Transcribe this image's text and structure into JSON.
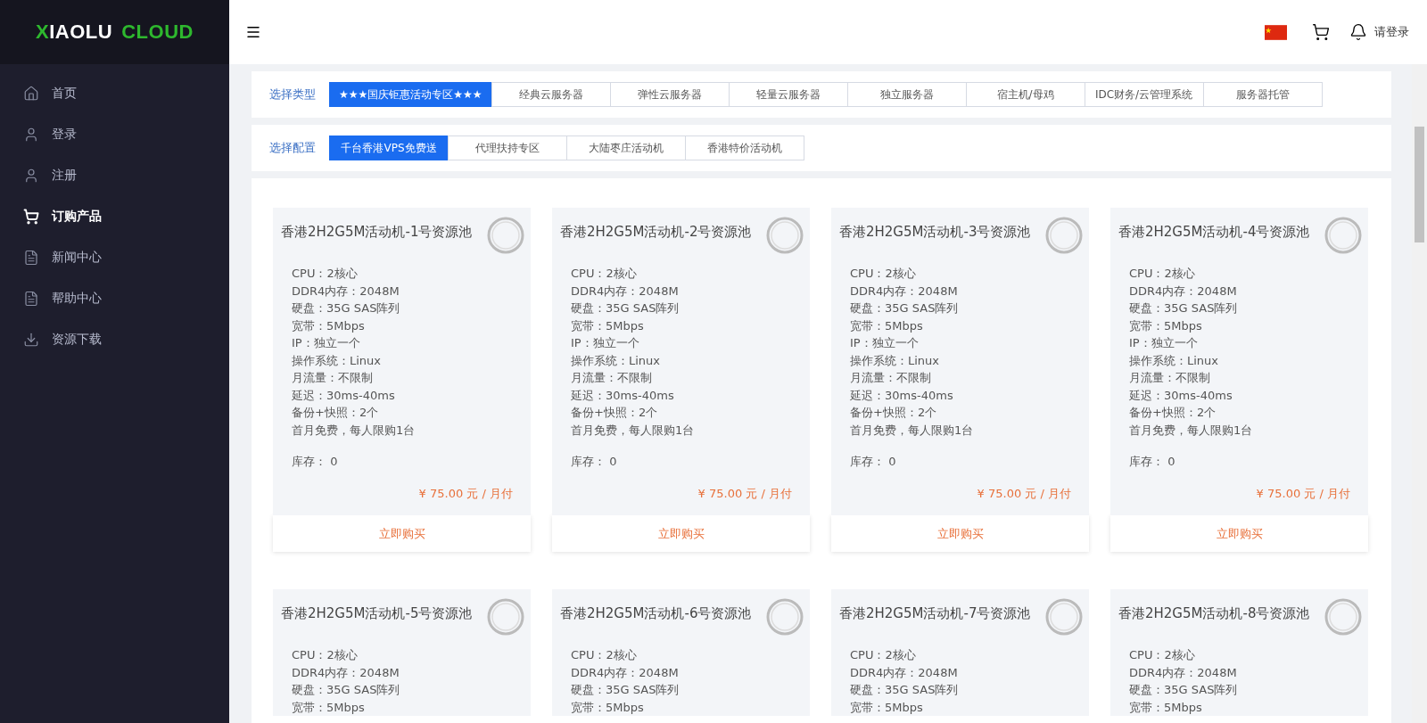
{
  "logo": {
    "mark": "X",
    "first": "IAOLU",
    "second": "CLOUD"
  },
  "sidebar": {
    "items": [
      {
        "label": "首页",
        "selected": false
      },
      {
        "label": "登录",
        "selected": false
      },
      {
        "label": "注册",
        "selected": false
      },
      {
        "label": "订购产品",
        "selected": true
      },
      {
        "label": "新闻中心",
        "selected": false
      },
      {
        "label": "帮助中心",
        "selected": false
      },
      {
        "label": "资源下载",
        "selected": false
      }
    ]
  },
  "header": {
    "login": "请登录"
  },
  "filters": [
    {
      "label": "选择类型",
      "options": [
        {
          "label": "★★★国庆钜惠活动专区★★★",
          "selected": true
        },
        {
          "label": "经典云服务器",
          "selected": false
        },
        {
          "label": "弹性云服务器",
          "selected": false
        },
        {
          "label": "轻量云服务器",
          "selected": false
        },
        {
          "label": "独立服务器",
          "selected": false
        },
        {
          "label": "宿主机/母鸡",
          "selected": false
        },
        {
          "label": "IDC财务/云管理系统",
          "selected": false
        },
        {
          "label": "服务器托管",
          "selected": false
        }
      ]
    },
    {
      "label": "选择配置",
      "options": [
        {
          "label": "千台香港VPS免费送",
          "selected": true
        },
        {
          "label": "代理扶持专区",
          "selected": false
        },
        {
          "label": "大陆枣庄活动机",
          "selected": false
        },
        {
          "label": "香港特价活动机",
          "selected": false
        }
      ]
    }
  ],
  "products": [
    {
      "title": "香港2H2G5M活动机-1号资源池",
      "specs": [
        "CPU：2核心",
        "DDR4内存：2048M",
        "硬盘：35G SAS阵列",
        "宽带：5Mbps",
        "IP：独立一个",
        "操作系统：Linux",
        "月流量：不限制",
        "延迟：30ms-40ms",
        "备份+快照：2个",
        "首月免费，每人限购1台"
      ],
      "stock": "库存： 0",
      "price": "¥ 75.00 元 / 月付",
      "button": "立即购买"
    },
    {
      "title": "香港2H2G5M活动机-2号资源池",
      "specs": [
        "CPU：2核心",
        "DDR4内存：2048M",
        "硬盘：35G SAS阵列",
        "宽带：5Mbps",
        "IP：独立一个",
        "操作系统：Linux",
        "月流量：不限制",
        "延迟：30ms-40ms",
        "备份+快照：2个",
        "首月免费，每人限购1台"
      ],
      "stock": "库存： 0",
      "price": "¥ 75.00 元 / 月付",
      "button": "立即购买"
    },
    {
      "title": "香港2H2G5M活动机-3号资源池",
      "specs": [
        "CPU：2核心",
        "DDR4内存：2048M",
        "硬盘：35G SAS阵列",
        "宽带：5Mbps",
        "IP：独立一个",
        "操作系统：Linux",
        "月流量：不限制",
        "延迟：30ms-40ms",
        "备份+快照：2个",
        "首月免费，每人限购1台"
      ],
      "stock": "库存： 0",
      "price": "¥ 75.00 元 / 月付",
      "button": "立即购买"
    },
    {
      "title": "香港2H2G5M活动机-4号资源池",
      "specs": [
        "CPU：2核心",
        "DDR4内存：2048M",
        "硬盘：35G SAS阵列",
        "宽带：5Mbps",
        "IP：独立一个",
        "操作系统：Linux",
        "月流量：不限制",
        "延迟：30ms-40ms",
        "备份+快照：2个",
        "首月免费，每人限购1台"
      ],
      "stock": "库存： 0",
      "price": "¥ 75.00 元 / 月付",
      "button": "立即购买"
    },
    {
      "title": "香港2H2G5M活动机-5号资源池",
      "specs": [
        "CPU：2核心",
        "DDR4内存：2048M",
        "硬盘：35G SAS阵列",
        "宽带：5Mbps"
      ]
    },
    {
      "title": "香港2H2G5M活动机-6号资源池",
      "specs": [
        "CPU：2核心",
        "DDR4内存：2048M",
        "硬盘：35G SAS阵列",
        "宽带：5Mbps"
      ]
    },
    {
      "title": "香港2H2G5M活动机-7号资源池",
      "specs": [
        "CPU：2核心",
        "DDR4内存：2048M",
        "硬盘：35G SAS阵列",
        "宽带：5Mbps"
      ]
    },
    {
      "title": "香港2H2G5M活动机-8号资源池",
      "specs": [
        "CPU：2核心",
        "DDR4内存：2048M",
        "硬盘：35G SAS阵列",
        "宽带：5Mbps"
      ]
    }
  ]
}
